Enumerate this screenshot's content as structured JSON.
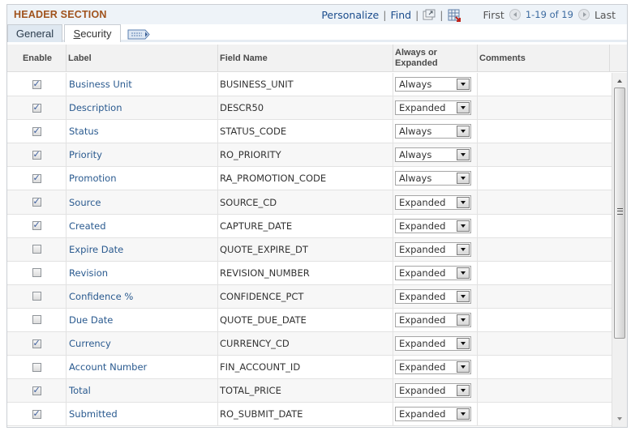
{
  "header": {
    "title": "HEADER SECTION",
    "nav": {
      "personalize": "Personalize",
      "find": "Find",
      "separator": "|",
      "first": "First",
      "counter": "1-19 of 19",
      "last": "Last"
    }
  },
  "tabs": [
    {
      "label": "General",
      "active": true
    },
    {
      "label": "Security",
      "active": false
    }
  ],
  "table": {
    "columns": [
      "Enable",
      "Label",
      "Field Name",
      "Always or Expanded",
      "Comments"
    ],
    "column_always_line1": "Always or",
    "column_always_line2": "Expanded",
    "rows": [
      {
        "enabled": true,
        "label": "Business Unit",
        "field": "BUSINESS_UNIT",
        "mode": "Always",
        "comments": ""
      },
      {
        "enabled": true,
        "label": "Description",
        "field": "DESCR50",
        "mode": "Expanded",
        "comments": ""
      },
      {
        "enabled": true,
        "label": "Status",
        "field": "STATUS_CODE",
        "mode": "Always",
        "comments": ""
      },
      {
        "enabled": true,
        "label": "Priority",
        "field": "RO_PRIORITY",
        "mode": "Always",
        "comments": ""
      },
      {
        "enabled": true,
        "label": "Promotion",
        "field": "RA_PROMOTION_CODE",
        "mode": "Always",
        "comments": ""
      },
      {
        "enabled": true,
        "label": "Source",
        "field": "SOURCE_CD",
        "mode": "Expanded",
        "comments": ""
      },
      {
        "enabled": true,
        "label": "Created",
        "field": "CAPTURE_DATE",
        "mode": "Expanded",
        "comments": ""
      },
      {
        "enabled": false,
        "label": "Expire Date",
        "field": "QUOTE_EXPIRE_DT",
        "mode": "Expanded",
        "comments": ""
      },
      {
        "enabled": false,
        "label": "Revision",
        "field": "REVISION_NUMBER",
        "mode": "Expanded",
        "comments": ""
      },
      {
        "enabled": false,
        "label": "Confidence %",
        "field": "CONFIDENCE_PCT",
        "mode": "Expanded",
        "comments": ""
      },
      {
        "enabled": false,
        "label": "Due Date",
        "field": "QUOTE_DUE_DATE",
        "mode": "Expanded",
        "comments": ""
      },
      {
        "enabled": true,
        "label": "Currency",
        "field": "CURRENCY_CD",
        "mode": "Expanded",
        "comments": ""
      },
      {
        "enabled": false,
        "label": "Account Number",
        "field": "FIN_ACCOUNT_ID",
        "mode": "Expanded",
        "comments": ""
      },
      {
        "enabled": true,
        "label": "Total",
        "field": "TOTAL_PRICE",
        "mode": "Expanded",
        "comments": ""
      },
      {
        "enabled": true,
        "label": "Submitted",
        "field": "RO_SUBMIT_DATE",
        "mode": "Expanded",
        "comments": ""
      }
    ]
  },
  "icons": {
    "new_window": "new-window-icon",
    "download": "download-to-excel-icon",
    "prev": "previous-icon",
    "next": "next-icon",
    "show_all_columns": "show-all-columns-icon"
  },
  "colors": {
    "section_title": "#a0521c",
    "link": "#1a4c8c",
    "label_text": "#2a5a8f",
    "header_bar": "#eef3f8"
  }
}
